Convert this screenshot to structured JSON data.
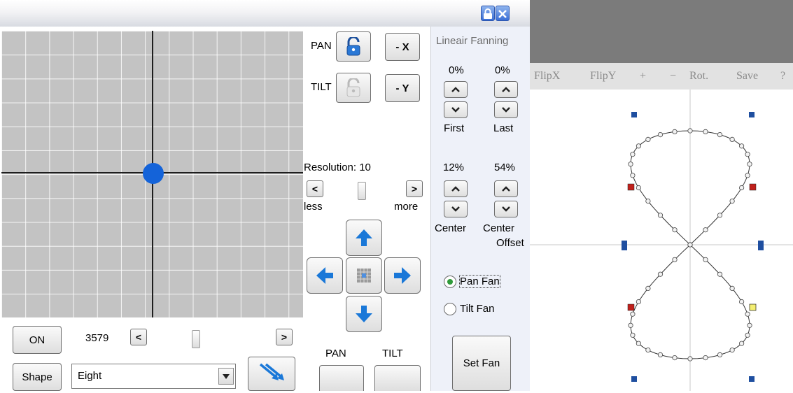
{
  "titlebar": {
    "lock_icon": "lock-icon",
    "close_icon": "close-icon"
  },
  "grid": {
    "accent": "#1463d9"
  },
  "pan": {
    "label": "PAN",
    "invert_label": "- X"
  },
  "tilt": {
    "label": "TILT",
    "invert_label": "- Y"
  },
  "resolution": {
    "label": "Resolution: 10",
    "less": "less",
    "more": "more",
    "left_arrow": "<",
    "right_arrow": ">"
  },
  "dpad": {
    "center_icon": "grid-center-icon"
  },
  "bottom": {
    "on_label": "ON",
    "position_value": "3579",
    "left_arrow": "<",
    "right_arrow": ">",
    "shape_label": "Shape",
    "shape_value": "Eight",
    "pan_label": "PAN",
    "tilt_label": "TILT"
  },
  "fanning": {
    "title": "Lineair Fanning",
    "first_value": "0%",
    "last_value": "0%",
    "first_label": "First",
    "last_label": "Last",
    "center_value": "12%",
    "center_offset_value": "54%",
    "center_label": "Center",
    "center_offset_label_1": "Center",
    "center_offset_label_2": "Offset",
    "up_glyph": "^",
    "down_glyph": "v",
    "pan_fan": "Pan Fan",
    "tilt_fan": "Tilt Fan",
    "set_fan": "Set Fan"
  },
  "toolbar": {
    "flipx": "FlipX",
    "flipy": "FlipY",
    "plus": "+",
    "minus": "−",
    "rot": "Rot.",
    "save": "Save",
    "help": "?"
  }
}
